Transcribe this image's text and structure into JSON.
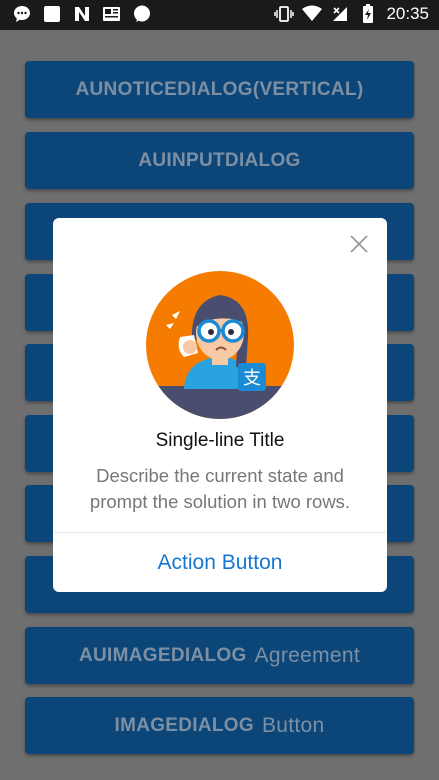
{
  "status_bar": {
    "time": "20:35",
    "left_icons": [
      "message-bubble-icon",
      "square-notification-icon",
      "n-app-icon",
      "news-icon",
      "messenger-icon"
    ],
    "right_icons": [
      "vibrate-icon",
      "wifi-icon",
      "no-signal-icon",
      "battery-charging-icon"
    ]
  },
  "list_buttons": [
    {
      "bold": "AUNOTICEDIALOG(VERTICAL)",
      "light": ""
    },
    {
      "bold": "AUINPUTDIALOG",
      "light": ""
    },
    {
      "bold": "AUIMAGEDIALOG",
      "light": "Agreement"
    },
    {
      "bold": "IMAGEDIALOG",
      "light": "Button"
    }
  ],
  "dialog": {
    "title": "Single-line Title",
    "description": "Describe the current state and prompt the solution in two rows.",
    "action_label": "Action Button",
    "illustration_icon": "worried-user-illustration",
    "close_icon": "close-icon"
  },
  "colors": {
    "accent": "#1677d2",
    "list_button_bg": "#0c4678",
    "overlay_bg": "#6f6f6f",
    "illustration_bg": "#f57c00"
  }
}
